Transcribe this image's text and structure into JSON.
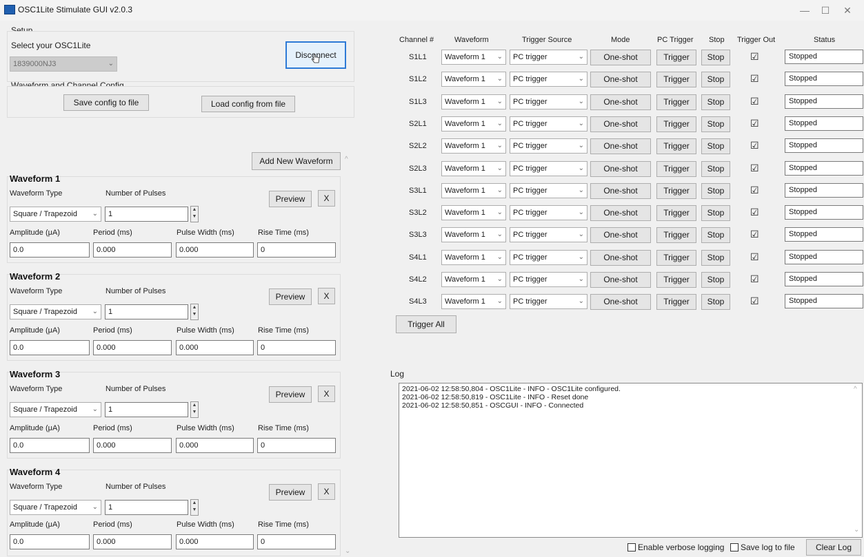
{
  "window": {
    "title": "OSC1Lite Stimulate GUI v2.0.3",
    "minimize": "—",
    "maximize": "☐",
    "close": "✕"
  },
  "setup": {
    "section_label": "Setup",
    "select_label": "Select your OSC1Lite",
    "device_value": "1839000NJ3",
    "disconnect_label": "Disconnect"
  },
  "config": {
    "section_label": "Waveform and Channel Config",
    "save_label": "Save config to file",
    "load_label": "Load config from file"
  },
  "add_waveform_label": "Add New Waveform",
  "waveform_labels": {
    "type": "Waveform Type",
    "pulses": "Number of Pulses",
    "amplitude": "Amplitude (μA)",
    "period": "Period (ms)",
    "pulse_width": "Pulse Width (ms)",
    "rise_time": "Rise Time (ms)",
    "preview": "Preview",
    "remove": "X"
  },
  "waveforms": [
    {
      "title": "Waveform 1",
      "type": "Square / Trapezoid",
      "pulses": "1",
      "amplitude": "0.0",
      "period": "0.000",
      "pulse_width": "0.000",
      "rise_time": "0"
    },
    {
      "title": "Waveform 2",
      "type": "Square / Trapezoid",
      "pulses": "1",
      "amplitude": "0.0",
      "period": "0.000",
      "pulse_width": "0.000",
      "rise_time": "0"
    },
    {
      "title": "Waveform 3",
      "type": "Square / Trapezoid",
      "pulses": "1",
      "amplitude": "0.0",
      "period": "0.000",
      "pulse_width": "0.000",
      "rise_time": "0"
    },
    {
      "title": "Waveform 4",
      "type": "Square / Trapezoid",
      "pulses": "1",
      "amplitude": "0.0",
      "period": "0.000",
      "pulse_width": "0.000",
      "rise_time": "0"
    }
  ],
  "channels": {
    "headers": [
      "Channel #",
      "Waveform",
      "Trigger Source",
      "Mode",
      "PC Trigger",
      "Stop",
      "Trigger Out",
      "Status"
    ],
    "rows": [
      {
        "name": "S1L1",
        "waveform": "Waveform 1",
        "trigger_source": "PC trigger",
        "mode": "One-shot",
        "trigger": "Trigger",
        "stop": "Stop",
        "trigger_out": "☑",
        "status": "Stopped"
      },
      {
        "name": "S1L2",
        "waveform": "Waveform 1",
        "trigger_source": "PC trigger",
        "mode": "One-shot",
        "trigger": "Trigger",
        "stop": "Stop",
        "trigger_out": "☑",
        "status": "Stopped"
      },
      {
        "name": "S1L3",
        "waveform": "Waveform 1",
        "trigger_source": "PC trigger",
        "mode": "One-shot",
        "trigger": "Trigger",
        "stop": "Stop",
        "trigger_out": "☑",
        "status": "Stopped"
      },
      {
        "name": "S2L1",
        "waveform": "Waveform 1",
        "trigger_source": "PC trigger",
        "mode": "One-shot",
        "trigger": "Trigger",
        "stop": "Stop",
        "trigger_out": "☑",
        "status": "Stopped"
      },
      {
        "name": "S2L2",
        "waveform": "Waveform 1",
        "trigger_source": "PC trigger",
        "mode": "One-shot",
        "trigger": "Trigger",
        "stop": "Stop",
        "trigger_out": "☑",
        "status": "Stopped"
      },
      {
        "name": "S2L3",
        "waveform": "Waveform 1",
        "trigger_source": "PC trigger",
        "mode": "One-shot",
        "trigger": "Trigger",
        "stop": "Stop",
        "trigger_out": "☑",
        "status": "Stopped"
      },
      {
        "name": "S3L1",
        "waveform": "Waveform 1",
        "trigger_source": "PC trigger",
        "mode": "One-shot",
        "trigger": "Trigger",
        "stop": "Stop",
        "trigger_out": "☑",
        "status": "Stopped"
      },
      {
        "name": "S3L2",
        "waveform": "Waveform 1",
        "trigger_source": "PC trigger",
        "mode": "One-shot",
        "trigger": "Trigger",
        "stop": "Stop",
        "trigger_out": "☑",
        "status": "Stopped"
      },
      {
        "name": "S3L3",
        "waveform": "Waveform 1",
        "trigger_source": "PC trigger",
        "mode": "One-shot",
        "trigger": "Trigger",
        "stop": "Stop",
        "trigger_out": "☑",
        "status": "Stopped"
      },
      {
        "name": "S4L1",
        "waveform": "Waveform 1",
        "trigger_source": "PC trigger",
        "mode": "One-shot",
        "trigger": "Trigger",
        "stop": "Stop",
        "trigger_out": "☑",
        "status": "Stopped"
      },
      {
        "name": "S4L2",
        "waveform": "Waveform 1",
        "trigger_source": "PC trigger",
        "mode": "One-shot",
        "trigger": "Trigger",
        "stop": "Stop",
        "trigger_out": "☑",
        "status": "Stopped"
      },
      {
        "name": "S4L3",
        "waveform": "Waveform 1",
        "trigger_source": "PC trigger",
        "mode": "One-shot",
        "trigger": "Trigger",
        "stop": "Stop",
        "trigger_out": "☑",
        "status": "Stopped"
      }
    ],
    "trigger_all_label": "Trigger All"
  },
  "log": {
    "section_label": "Log",
    "lines": [
      "2021-06-02 12:58:50,804 - OSC1Lite - INFO - OSC1Lite configured.",
      "2021-06-02 12:58:50,819 - OSC1Lite - INFO - Reset done",
      "2021-06-02 12:58:50,851 - OSCGUI - INFO - Connected"
    ],
    "verbose_label": "Enable verbose logging",
    "save_label": "Save log to file",
    "clear_label": "Clear Log"
  }
}
